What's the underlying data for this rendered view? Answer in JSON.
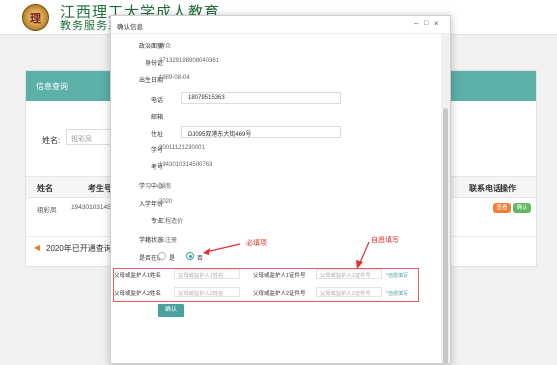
{
  "header": {
    "logo_text": "理",
    "title": "江西理工大学成人教育",
    "subtitle": "教务服务系"
  },
  "panel": {
    "title": "信息查询",
    "name_label": "姓名:",
    "name_value": "祖彩凤",
    "columns": {
      "name": "姓名",
      "id": "考生号",
      "phone": "联系电话",
      "action": "操作"
    },
    "row": {
      "name": "祖彩凤",
      "id": "194301031450"
    },
    "actions": {
      "view": "查看",
      "confirm": "确认"
    },
    "notice": "2020年已开通查询省"
  },
  "modal": {
    "title": "确认信息",
    "fields": [
      {
        "label": "政治面貌",
        "value": "群众"
      },
      {
        "label": "身份证",
        "value": "371329198908040361"
      },
      {
        "label": "出生日期",
        "value": "1989-08-04"
      },
      {
        "label": "电话",
        "value": "18079515363"
      },
      {
        "label": "邮箱",
        "value": ""
      },
      {
        "label": "住址",
        "value": "DJ095双港东大街469号"
      },
      {
        "label": "学号",
        "value": "20011121230001"
      },
      {
        "label": "考号",
        "value": "1943010314500763"
      },
      {
        "label": "学习中心",
        "value": "湖南"
      },
      {
        "label": "入学年份",
        "value": "2020"
      },
      {
        "label": "专业",
        "value": "工程造价"
      },
      {
        "label": "学籍状态",
        "value": "未注册"
      }
    ],
    "employed": {
      "label": "是否在职",
      "yes": "是",
      "no": "否"
    },
    "guardians": {
      "g1_name_label": "父母或监护人1姓名",
      "g1_name_placeholder": "父母或监护人1姓名",
      "g1_id_label": "父母或监护人1证件号",
      "g1_id_placeholder": "父母或监护人1证件号",
      "g2_name_label": "父母或监护人2姓名",
      "g2_name_placeholder": "父母或监护人2姓名",
      "g2_id_label": "父母或监护人2证件号",
      "g2_id_placeholder": "父母或监护人2证件号",
      "hint": "*自愿填写"
    },
    "confirm_label": "确认"
  },
  "annotations": {
    "required": "必填项",
    "optional": "自愿填写"
  },
  "colors": {
    "accent": "#46a29b",
    "annotation": "#e23030",
    "view_button": "#f07f3a",
    "confirm_button": "#5fb960"
  }
}
